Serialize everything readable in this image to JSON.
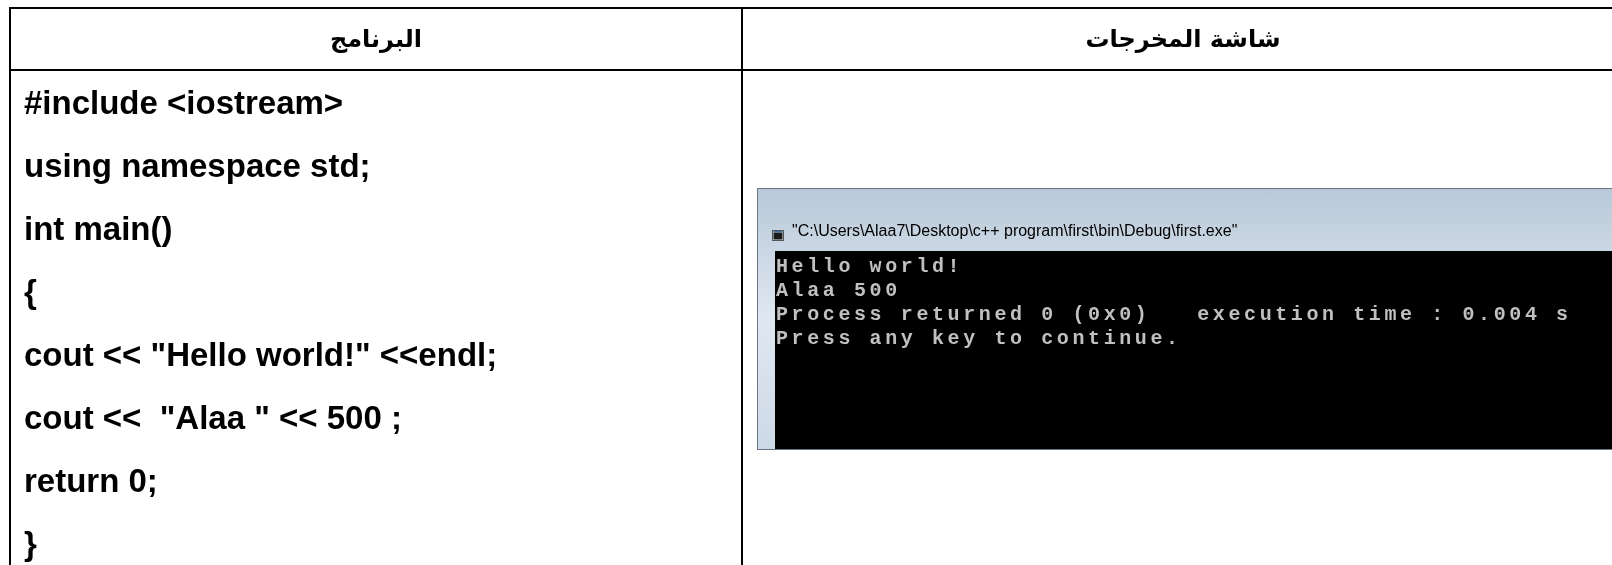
{
  "table": {
    "headers": [
      "شاشة المخرجات",
      "البرنامج"
    ],
    "program_lines": [
      "#include <iostream>",
      "using namespace std;",
      "int main()",
      "{",
      "cout << \"Hello world!\" <<endl;",
      "cout <<  \"Alaa \" << 500 ;",
      "return 0;",
      "}"
    ],
    "output_window": {
      "title": "\"C:\\Users\\Alaa7\\Desktop\\c++ program\\first\\bin\\Debug\\first.exe\"",
      "lines": [
        "Hello world!",
        "Alaa 500",
        "Process returned 0 (0x0)   execution time : 0.004 s",
        "Press any key to continue."
      ]
    }
  }
}
